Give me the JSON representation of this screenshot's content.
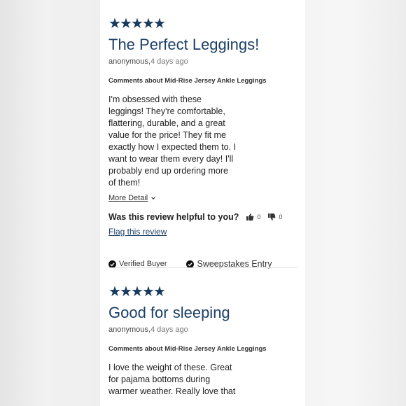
{
  "reviews": [
    {
      "stars": [
        "★",
        "★",
        "★",
        "★",
        "★"
      ],
      "title": "The Perfect Leggings!",
      "author": "anonymous,",
      "date": "4 days ago",
      "comments_label": "Comments about Mid-Rise Jersey Ankle Leggings",
      "body_lines": [
        "I'm obsessed with these",
        "leggings! They're comfortable,",
        "flattering, durable, and a great",
        "value for the price! They fit me",
        "exactly how I expected them to. I",
        "want to wear them every day! I'll",
        "probably end up ordering more",
        "of them!"
      ],
      "more_detail": "More Detail",
      "helpful_question": "Was this review helpful to you?",
      "helpful_up": "0",
      "helpful_down": "0",
      "flag": "Flag this review",
      "verified_buyer": "Verified Buyer",
      "sweepstakes": "Sweepstakes Entry"
    },
    {
      "stars": [
        "★",
        "★",
        "★",
        "★",
        "★"
      ],
      "title": "Good for sleeping",
      "author": "anonymous,",
      "date": "4 days ago",
      "comments_label": "Comments about Mid-Rise Jersey Ankle Leggings",
      "body_lines": [
        "I love the weight of these. Great",
        "for pajama bottoms during",
        "warmer weather. Really love that"
      ]
    }
  ],
  "icons": {
    "star": "star-icon",
    "thumbs_up": "thumbs-up-icon",
    "thumbs_down": "thumbs-down-icon",
    "chevron": "chevron-down-icon",
    "check": "check-circle-icon"
  },
  "colors": {
    "accent": "#173a5e",
    "title": "#1b3f66",
    "text": "#222222",
    "muted": "#777777",
    "divider": "#dcdcdc"
  }
}
